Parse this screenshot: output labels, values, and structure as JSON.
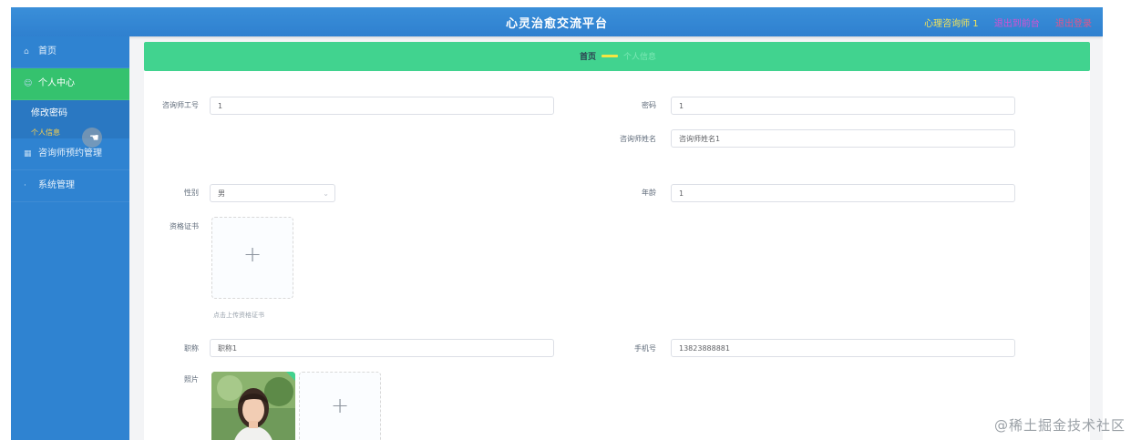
{
  "header": {
    "title": "心灵治愈交流平台",
    "user": "心理咨询师 1",
    "link_a": "退出到前台",
    "link_b": "退出登录"
  },
  "sidebar": {
    "items": [
      {
        "label": "首页",
        "icon": "home-icon"
      },
      {
        "label": "个人中心",
        "icon": "user-icon",
        "active": true
      },
      {
        "label": "咨询师预约管理",
        "icon": "grid-icon"
      },
      {
        "label": "系统管理",
        "icon": "settings-icon"
      }
    ],
    "sub_items": [
      {
        "label": "修改密码"
      },
      {
        "label": "个人信息"
      }
    ]
  },
  "breadcrumb": {
    "home": "首页",
    "current": "个人信息"
  },
  "form": {
    "consultant_id_label": "咨询师工号",
    "consultant_id_value": "1",
    "password_label": "密码",
    "password_value": "1",
    "name_label": "咨询师姓名",
    "name_value": "咨询师姓名1",
    "gender_label": "性别",
    "gender_value": "男",
    "age_label": "年龄",
    "age_value": "1",
    "cert_label": "资格证书",
    "cert_tip": "点击上传资格证书",
    "title_label": "职称",
    "title_value": "职称1",
    "phone_label": "手机号",
    "phone_value": "13823888881",
    "photo_label": "照片"
  },
  "watermark": "@稀土掘金技术社区"
}
